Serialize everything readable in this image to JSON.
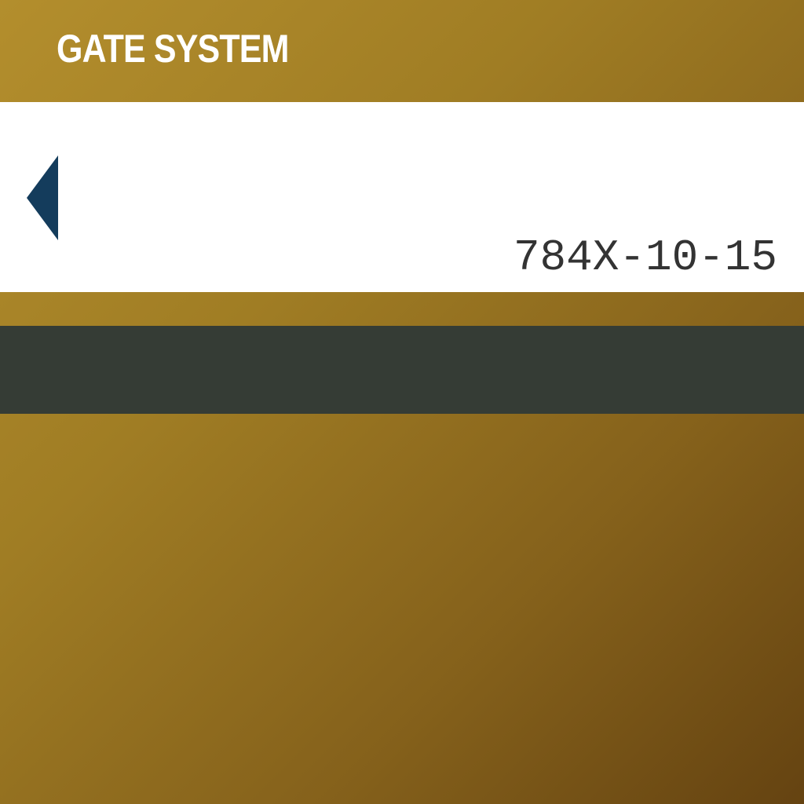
{
  "header": {
    "title": "GATE SYSTEM"
  },
  "display": {
    "back_icon": "triangle-left-icon",
    "code": "784X-10-15"
  },
  "colors": {
    "background_gradient_start": "#B38E2D",
    "background_gradient_end": "#654311",
    "panel": "#ffffff",
    "back_icon": "#143C5C",
    "code_text": "#333333",
    "status_bar": "#353C35"
  }
}
